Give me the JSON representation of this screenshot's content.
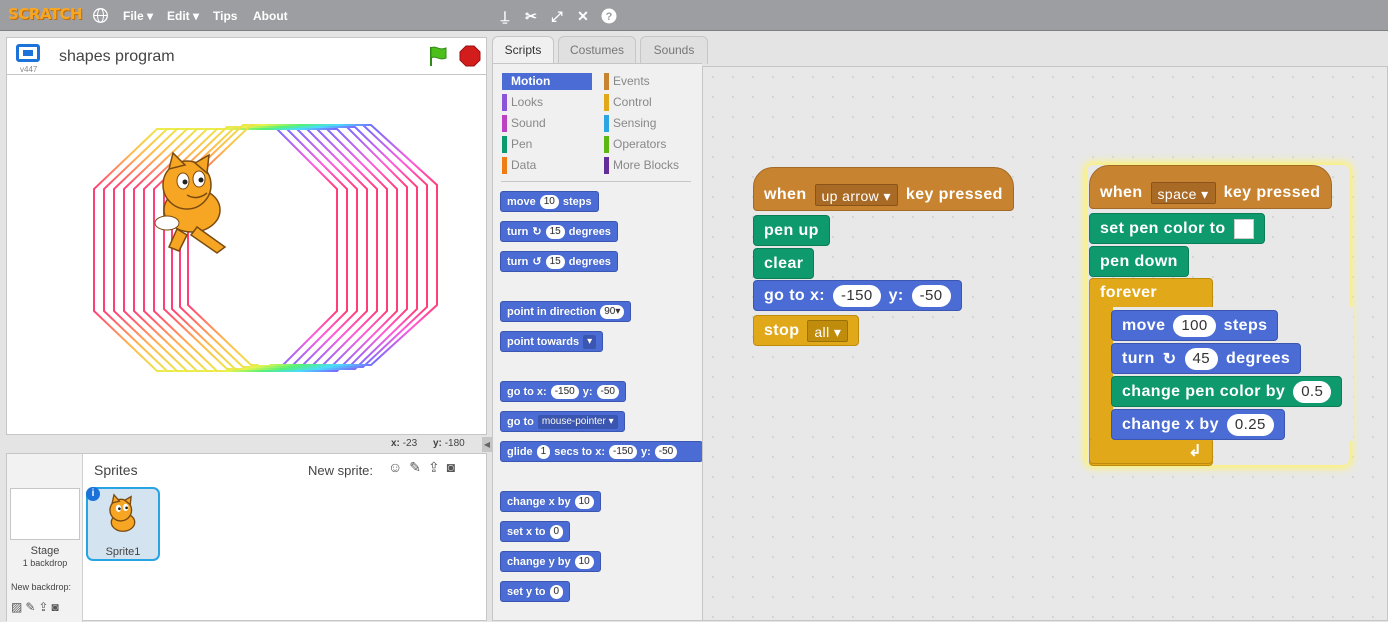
{
  "app": {
    "logo": "SCRATCH"
  },
  "menu": {
    "file": "File ▾",
    "edit": "Edit ▾",
    "tips": "Tips",
    "about": "About"
  },
  "stage_header": {
    "title": "shapes program",
    "version": "v447"
  },
  "stage_coords": {
    "x_label": "x:",
    "x_value": "-23",
    "y_label": "y:",
    "y_value": "-180"
  },
  "sprites": {
    "header": "Sprites",
    "new_sprite": "New sprite:",
    "stage_label": "Stage",
    "stage_sub": "1 backdrop",
    "new_backdrop": "New backdrop:",
    "items": [
      {
        "name": "Sprite1"
      }
    ]
  },
  "tabs": [
    "Scripts",
    "Costumes",
    "Sounds"
  ],
  "categories": {
    "left": [
      {
        "label": "Motion",
        "color": "#4a6cd4"
      },
      {
        "label": "Looks",
        "color": "#8a55d7"
      },
      {
        "label": "Sound",
        "color": "#bb42c3"
      },
      {
        "label": "Pen",
        "color": "#0e9a6c"
      },
      {
        "label": "Data",
        "color": "#ee7d16"
      }
    ],
    "right": [
      {
        "label": "Events",
        "color": "#c88330"
      },
      {
        "label": "Control",
        "color": "#e1a91a"
      },
      {
        "label": "Sensing",
        "color": "#2ca5e2"
      },
      {
        "label": "Operators",
        "color": "#5cb712"
      },
      {
        "label": "More Blocks",
        "color": "#632d99"
      }
    ]
  },
  "palette": {
    "move": {
      "a": "move",
      "n": "10",
      "b": "steps"
    },
    "turn_cw": {
      "a": "turn",
      "n": "15",
      "b": "degrees"
    },
    "turn_ccw": {
      "a": "turn",
      "n": "15",
      "b": "degrees"
    },
    "point_dir": {
      "a": "point in direction",
      "n": "90▾"
    },
    "point_towards": {
      "a": "point towards"
    },
    "goto_xy": {
      "a": "go to x:",
      "x": "-150",
      "b": "y:",
      "y": "-50"
    },
    "goto": {
      "a": "go to",
      "d": "mouse-pointer ▾"
    },
    "glide": {
      "a": "glide",
      "n": "1",
      "b": "secs to x:",
      "x": "-150",
      "c": "y:",
      "y": "-50"
    },
    "change_x": {
      "a": "change x by",
      "n": "10"
    },
    "set_x": {
      "a": "set x to",
      "n": "0"
    },
    "change_y": {
      "a": "change y by",
      "n": "10"
    },
    "set_y": {
      "a": "set y to",
      "n": "0"
    }
  },
  "script1": {
    "hat": {
      "a": "when",
      "key": "up arrow ▾",
      "b": "key pressed"
    },
    "pen_up": "pen up",
    "clear": "clear",
    "goto": {
      "a": "go to x:",
      "x": "-150",
      "b": "y:",
      "y": "-50"
    },
    "stop": {
      "a": "stop",
      "opt": "all ▾"
    }
  },
  "script2": {
    "hat": {
      "a": "when",
      "key": "space ▾",
      "b": "key pressed"
    },
    "set_pen": "set pen color to",
    "pen_down": "pen down",
    "forever": "forever",
    "move": {
      "a": "move",
      "n": "100",
      "b": "steps"
    },
    "turn": {
      "a": "turn",
      "n": "45",
      "b": "degrees"
    },
    "change_pen": {
      "a": "change pen color by",
      "n": "0.5"
    },
    "change_x": {
      "a": "change x by",
      "n": "0.25"
    },
    "loop_arrow": "↲"
  }
}
